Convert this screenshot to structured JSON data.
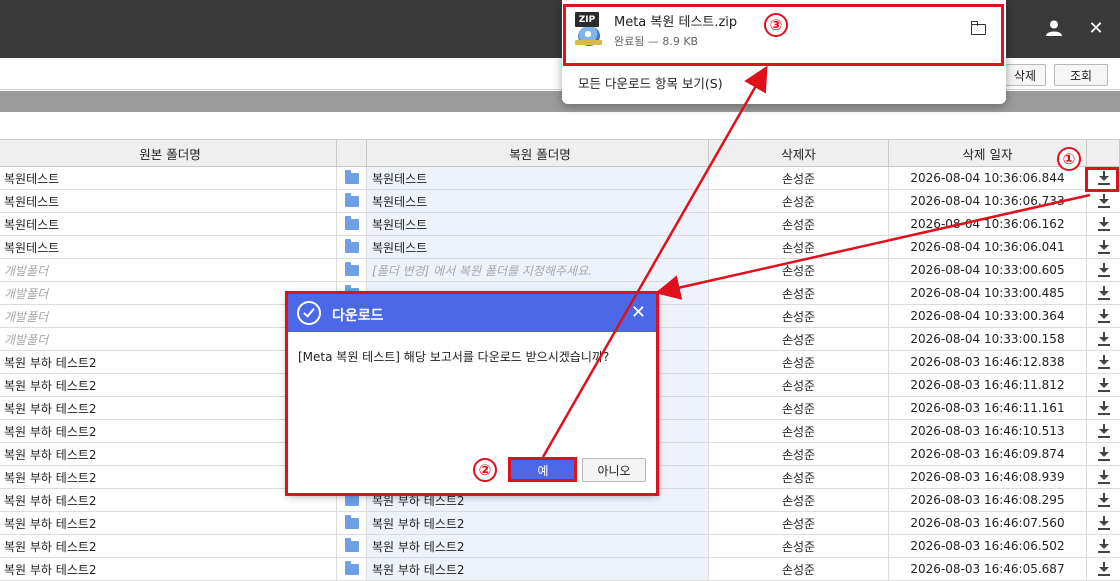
{
  "toolbar": {
    "delete_label": "삭제",
    "search_label": "조회"
  },
  "grid": {
    "headers": {
      "orig": "원본 폴더명",
      "restore": "복원 폴더명",
      "user": "삭제자",
      "date": "삭제 일자"
    },
    "rows": [
      {
        "orig": "복원테스트",
        "restore": "복원테스트",
        "user": "손성준",
        "date": "2026-08-04 10:36:06.844",
        "muted": false
      },
      {
        "orig": "복원테스트",
        "restore": "복원테스트",
        "user": "손성준",
        "date": "2026-08-04 10:36:06.733",
        "muted": false
      },
      {
        "orig": "복원테스트",
        "restore": "복원테스트",
        "user": "손성준",
        "date": "2026-08-04 10:36:06.162",
        "muted": false
      },
      {
        "orig": "복원테스트",
        "restore": "복원테스트",
        "user": "손성준",
        "date": "2026-08-04 10:36:06.041",
        "muted": false
      },
      {
        "orig": "개발폴더",
        "restore": "[폴더 변경] 에서 복원 폴더를 지정해주세요.",
        "user": "손성준",
        "date": "2026-08-04 10:33:00.605",
        "muted": true
      },
      {
        "orig": "개발폴더",
        "restore": "",
        "user": "손성준",
        "date": "2026-08-04 10:33:00.485",
        "muted": true
      },
      {
        "orig": "개발폴더",
        "restore": "",
        "user": "손성준",
        "date": "2026-08-04 10:33:00.364",
        "muted": true
      },
      {
        "orig": "개발폴더",
        "restore": "",
        "user": "손성준",
        "date": "2026-08-04 10:33:00.158",
        "muted": true
      },
      {
        "orig": "복원 부하 테스트2",
        "restore": "",
        "user": "손성준",
        "date": "2026-08-03 16:46:12.838",
        "muted": false
      },
      {
        "orig": "복원 부하 테스트2",
        "restore": "",
        "user": "손성준",
        "date": "2026-08-03 16:46:11.812",
        "muted": false
      },
      {
        "orig": "복원 부하 테스트2",
        "restore": "",
        "user": "손성준",
        "date": "2026-08-03 16:46:11.161",
        "muted": false
      },
      {
        "orig": "복원 부하 테스트2",
        "restore": "",
        "user": "손성준",
        "date": "2026-08-03 16:46:10.513",
        "muted": false
      },
      {
        "orig": "복원 부하 테스트2",
        "restore": "",
        "user": "손성준",
        "date": "2026-08-03 16:46:09.874",
        "muted": false
      },
      {
        "orig": "복원 부하 테스트2",
        "restore": "",
        "user": "손성준",
        "date": "2026-08-03 16:46:08.939",
        "muted": false
      },
      {
        "orig": "복원 부하 테스트2",
        "restore": "복원 부하 테스트2",
        "user": "손성준",
        "date": "2026-08-03 16:46:08.295",
        "muted": false
      },
      {
        "orig": "복원 부하 테스트2",
        "restore": "복원 부하 테스트2",
        "user": "손성준",
        "date": "2026-08-03 16:46:07.560",
        "muted": false
      },
      {
        "orig": "복원 부하 테스트2",
        "restore": "복원 부하 테스트2",
        "user": "손성준",
        "date": "2026-08-03 16:46:06.502",
        "muted": false
      },
      {
        "orig": "복원 부하 테스트2",
        "restore": "복원 부하 테스트2",
        "user": "손성준",
        "date": "2026-08-03 16:46:05.687",
        "muted": false
      }
    ]
  },
  "download_popup": {
    "file_name": "Meta 복원 테스트.zip",
    "status": "완료됨 — 8.9 KB",
    "show_all": "모든 다운로드 항목 보기(S)",
    "file_icon_label": "ZIP"
  },
  "dialog": {
    "title": "다운로드",
    "message": "[Meta 복원 테스트] 해당 보고서를 다운로드 받으시겠습니까?",
    "yes_label": "예",
    "no_label": "아니오"
  },
  "annotations": {
    "step1": "①",
    "step2": "②",
    "step3": "③"
  },
  "colors": {
    "accent": "#4a68e8",
    "annotation": "#e0101c",
    "topbar": "#3a3a3a"
  }
}
